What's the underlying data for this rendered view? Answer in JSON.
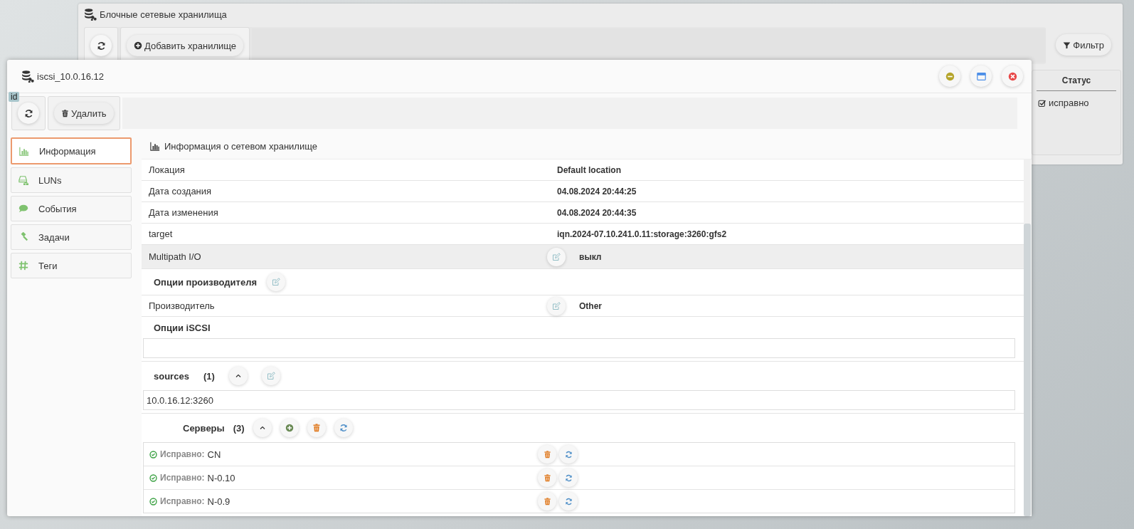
{
  "background_window": {
    "title": "Блочные сетевые хранилища",
    "add_button": "Добавить хранилище",
    "filter_button": "Фильтр",
    "table": {
      "columns": [
        "Статус"
      ],
      "rows": [
        {
          "status": "исправно",
          "checked": true
        }
      ]
    }
  },
  "dialog": {
    "title": "iscsi_10.0.16.12",
    "id_badge": "id",
    "delete_button": "Удалить",
    "sidebar": {
      "items": [
        {
          "label": "Информация",
          "kind": "chart",
          "selected": true
        },
        {
          "label": "LUNs",
          "kind": "drive",
          "selected": false
        },
        {
          "label": "События",
          "kind": "comment",
          "selected": false
        },
        {
          "label": "Задачи",
          "kind": "gavel",
          "selected": false
        },
        {
          "label": "Теги",
          "kind": "hash",
          "selected": false
        }
      ]
    },
    "section_title": "Информация о сетевом хранилище",
    "properties": [
      {
        "label": "Локация",
        "value": "Default location",
        "editable": false,
        "highlighted": false
      },
      {
        "label": "Дата создания",
        "value": "04.08.2024 20:44:25",
        "editable": false,
        "highlighted": false
      },
      {
        "label": "Дата изменения",
        "value": "04.08.2024 20:44:35",
        "editable": false,
        "highlighted": false
      },
      {
        "label": "target",
        "value": "iqn.2024-07.10.241.0.11:storage:3260:gfs2",
        "editable": false,
        "highlighted": false
      },
      {
        "label": "Multipath I/O",
        "value": "выкл",
        "editable": true,
        "highlighted": true
      }
    ],
    "vendor_options": {
      "title": "Опции производителя",
      "properties": [
        {
          "label": "Производитель",
          "value": "Other",
          "editable": true,
          "highlighted": false
        }
      ]
    },
    "iscsi_options": {
      "title": "Опции iSCSI"
    },
    "sources": {
      "title": "sources",
      "count": "(1)",
      "expanded": true,
      "items": [
        "10.0.16.12:3260"
      ]
    },
    "servers": {
      "title": "Серверы",
      "count": "(3)",
      "expanded": true,
      "items": [
        {
          "status": "Исправно:",
          "name": "CN"
        },
        {
          "status": "Исправно:",
          "name": "N-0.10"
        },
        {
          "status": "Исправно:",
          "name": "N-0.9"
        }
      ]
    }
  }
}
